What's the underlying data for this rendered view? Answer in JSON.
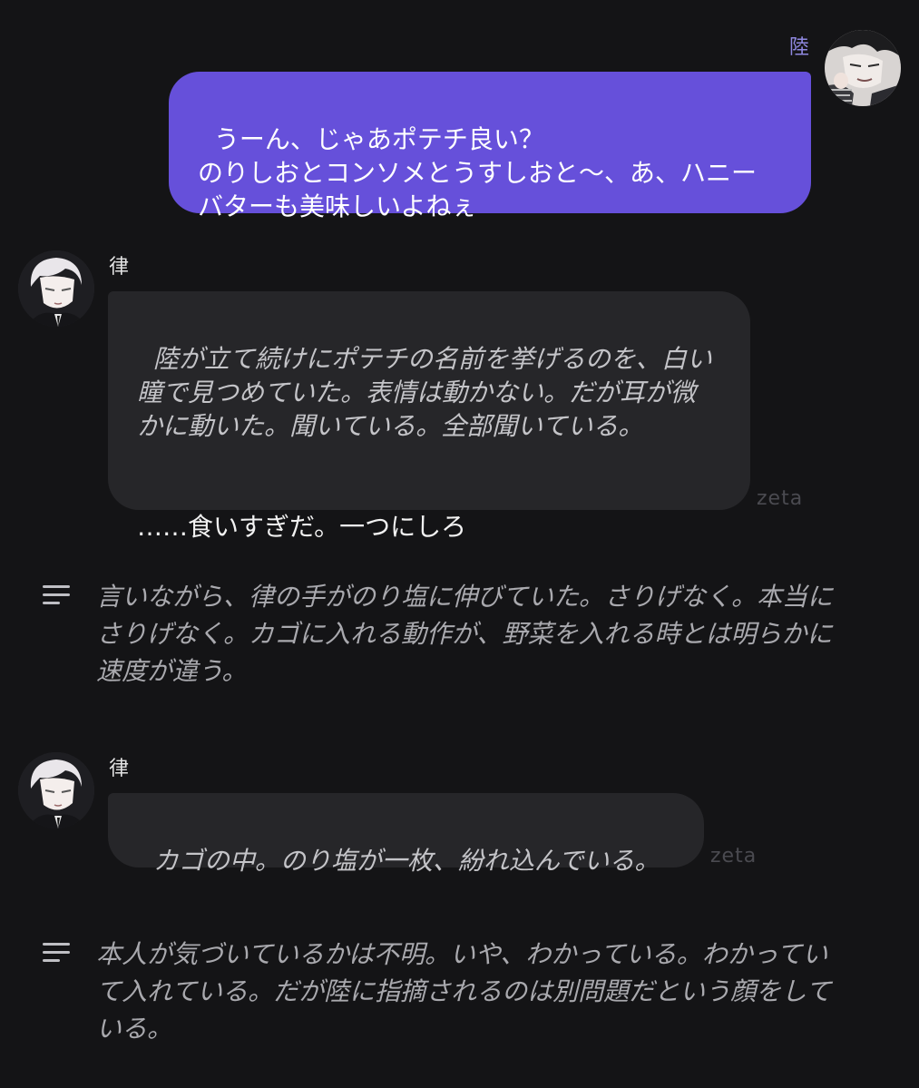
{
  "messages": [
    {
      "role": "user",
      "name": "陸",
      "text": "うーん、じゃあポテチ良い？\nのりしおとコンソメとうすしおと〜、あ、ハニー\nバターも美味しいよねぇ"
    },
    {
      "role": "bot",
      "name": "律",
      "narration": "陸が立て続けにポテチの名前を挙げるのを、白い\n瞳で見つめていた。表情は動かない。だが耳が微\nかに動いた。聞いている。全部聞いている。",
      "speech": "……食いすぎだ。一つにしろ",
      "brand": "zeta"
    },
    {
      "role": "narration",
      "icon": "lines-icon",
      "text": "言いながら、律の手がのり塩に伸びていた。さりげなく。本当に\nさりげなく。カゴに入れる動作が、野菜を入れる時とは明らかに\n速度が違う。"
    },
    {
      "role": "bot",
      "name": "律",
      "narration": "カゴの中。のり塩が一枚、紛れ込んでいる。",
      "brand": "zeta"
    },
    {
      "role": "narration",
      "icon": "lines-icon",
      "text": "本人が気づいているかは不明。いや、わかっている。わかってい\nて入れている。だが陸に指摘されるのは別問題だという顔をして\nいる。"
    }
  ],
  "colors": {
    "background": "#141416",
    "user_bubble": "#6650da",
    "bot_bubble": "#262629",
    "user_name": "#8f88e0",
    "muted_brand": "#4a4a50"
  }
}
